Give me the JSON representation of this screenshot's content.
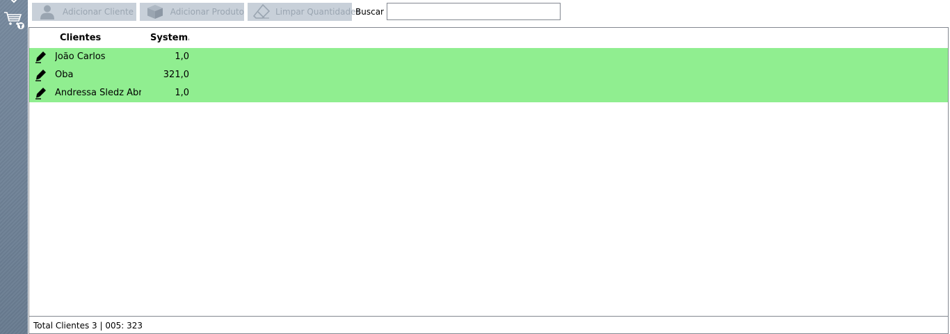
{
  "sidebar": {
    "icons": [
      "chevron-down-icon",
      "cart-filter-icon"
    ],
    "color": "#6e8298"
  },
  "toolbar": {
    "add_client_label": "Adicionar Cliente",
    "add_product_label": "Adicionar Produto",
    "clear_quantities_label": "Limpar Quantidades",
    "search_label": "Buscar",
    "search_value": "",
    "button_color": "#c8d0d9",
    "button_text_color": "#9aa5b1"
  },
  "grid": {
    "columns": [
      "Clientes",
      "System.V"
    ],
    "rows": [
      {
        "name": "João Carlos",
        "value": "1,0"
      },
      {
        "name": "Oba",
        "value": "321,0"
      },
      {
        "name": "Andressa Sledz Abra",
        "value": "1,0"
      }
    ],
    "row_color": "#90ee90"
  },
  "status": {
    "text": "Total Clientes 3 | 005: 323"
  }
}
